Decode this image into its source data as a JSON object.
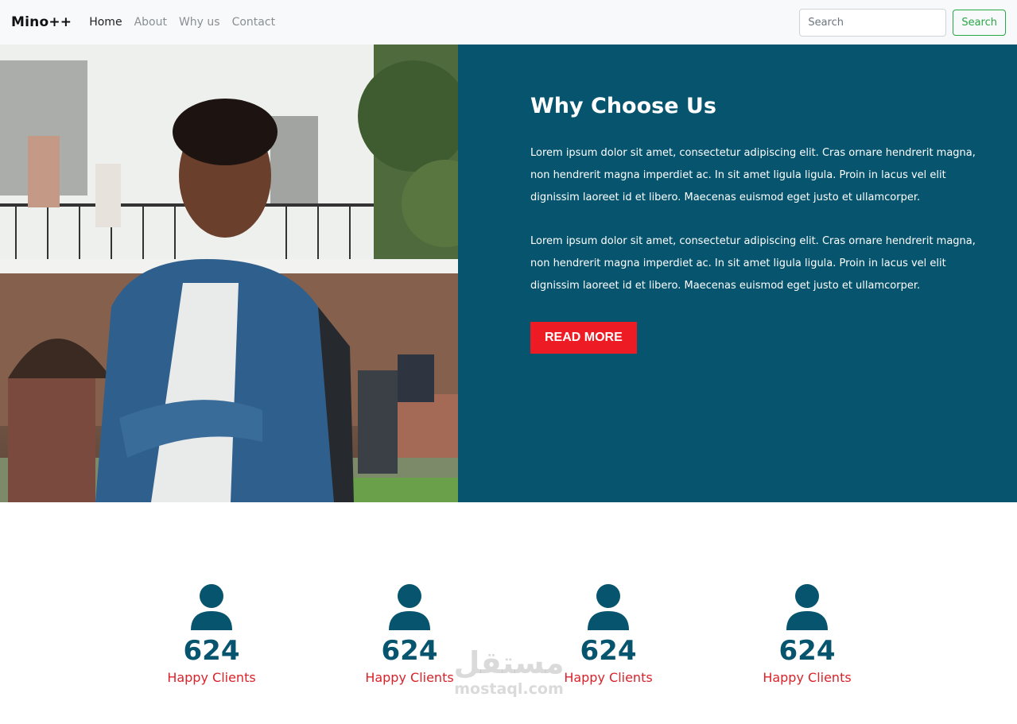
{
  "navbar": {
    "brand": "Mino++",
    "links": [
      {
        "label": "Home",
        "active": true
      },
      {
        "label": "About",
        "active": false
      },
      {
        "label": "Why us",
        "active": false
      },
      {
        "label": "Contact",
        "active": false
      }
    ],
    "search": {
      "placeholder": "Search",
      "button_label": "Search"
    }
  },
  "hero": {
    "title": "Why Choose Us",
    "paragraphs": [
      "Lorem ipsum dolor sit amet, consectetur adipiscing elit. Cras ornare hendrerit magna, non hendrerit magna imperdiet ac. In sit amet ligula ligula. Proin in lacus vel elit dignissim laoreet id et libero. Maecenas euismod eget justo et ullamcorper.",
      "Lorem ipsum dolor sit amet, consectetur adipiscing elit. Cras ornare hendrerit magna, non hendrerit magna imperdiet ac. In sit amet ligula ligula. Proin in lacus vel elit dignissim laoreet id et libero. Maecenas euismod eget justo et ullamcorper."
    ],
    "button_label": "READ MORE"
  },
  "stats": [
    {
      "icon": "user-icon",
      "number": "624",
      "label": "Happy Clients"
    },
    {
      "icon": "user-icon",
      "number": "624",
      "label": "Happy Clients"
    },
    {
      "icon": "user-icon",
      "number": "624",
      "label": "Happy Clients"
    },
    {
      "icon": "user-icon",
      "number": "624",
      "label": "Happy Clients"
    }
  ],
  "watermark": {
    "arabic": "مستقل",
    "latin": "mostaql.com"
  },
  "colors": {
    "panel": "#06546e",
    "accent_red": "#ed1c24",
    "stat_label": "#d9232b",
    "search_green": "#28a745"
  }
}
